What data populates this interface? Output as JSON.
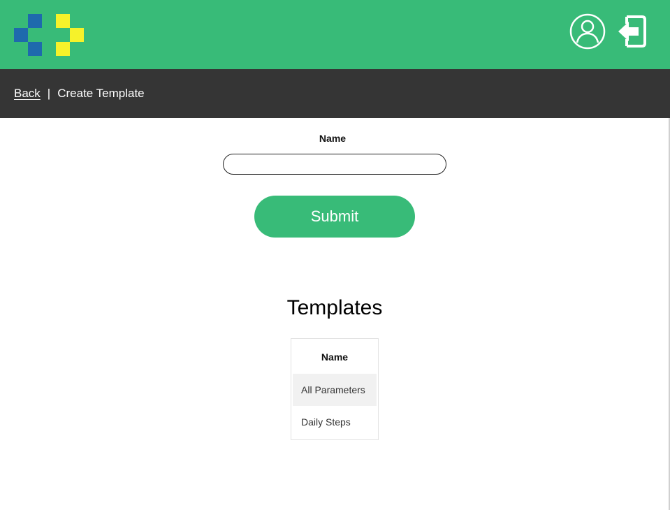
{
  "colors": {
    "brand_green": "#38bb78",
    "subnav_bg": "#353535",
    "logo_blue": "#1e6aad",
    "logo_yellow": "#f6f22a"
  },
  "header": {
    "logo_icon": "pixel-logo-icon",
    "profile_icon": "user-circle-icon",
    "logout_icon": "logout-arrow-icon"
  },
  "subnav": {
    "back_label": "Back",
    "separator": "|",
    "page_title": "Create Template"
  },
  "form": {
    "name_label": "Name",
    "name_value": "",
    "submit_label": "Submit"
  },
  "templates": {
    "heading": "Templates",
    "column_header": "Name",
    "rows": [
      "All Parameters",
      "Daily Steps"
    ]
  }
}
